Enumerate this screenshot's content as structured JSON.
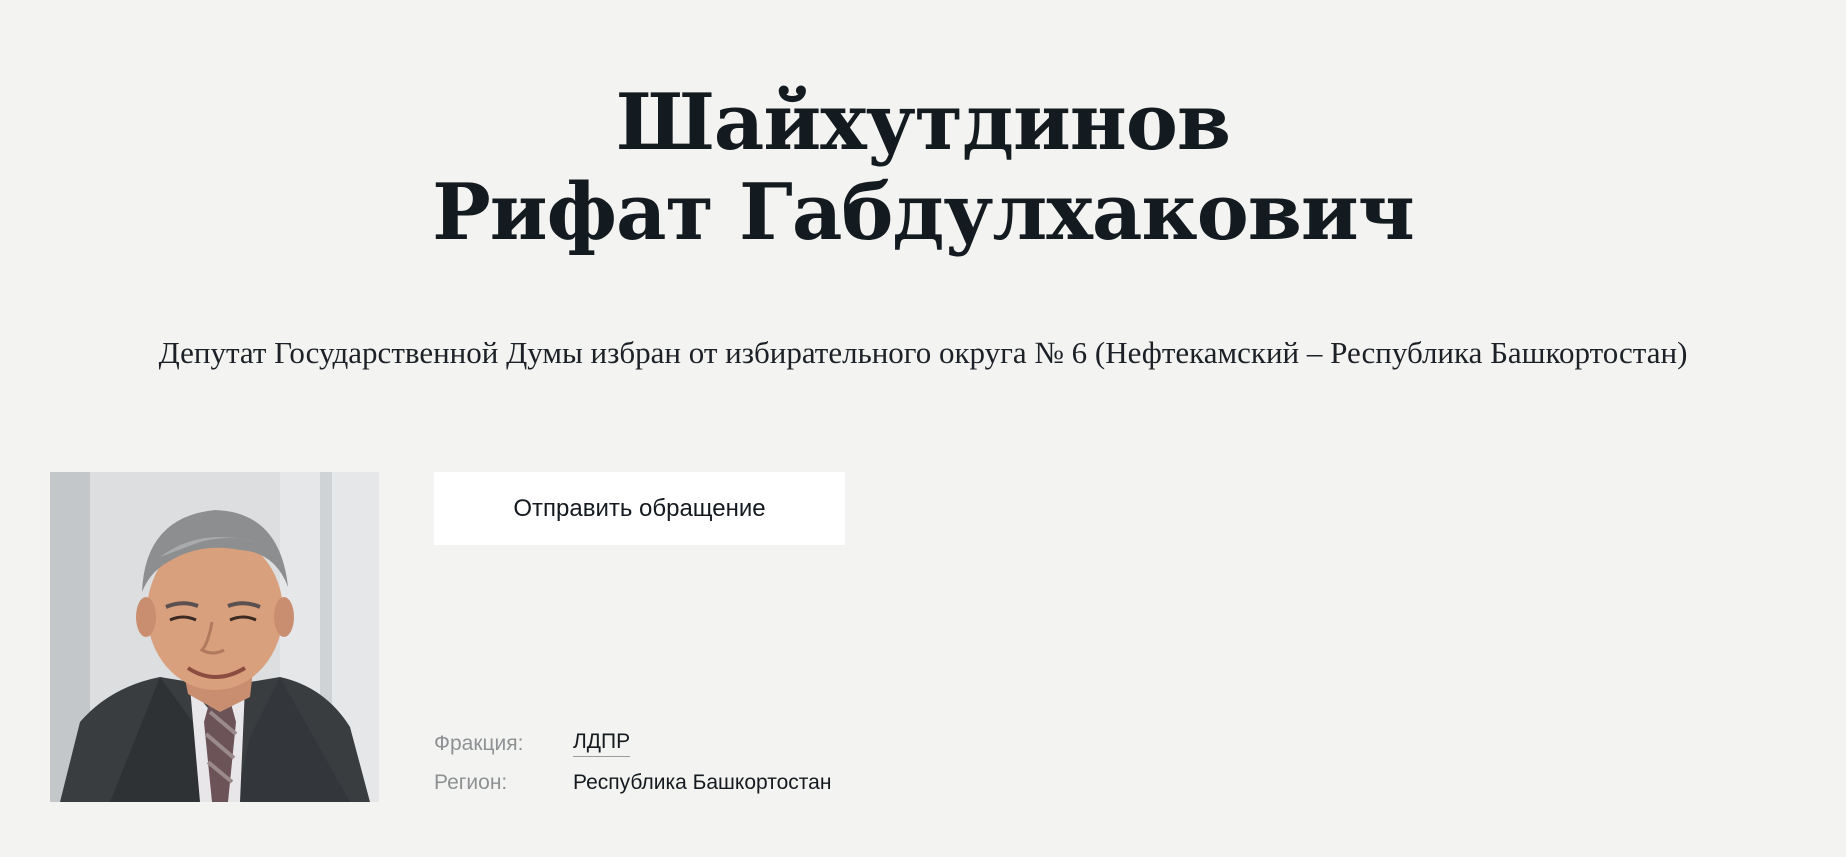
{
  "deputy": {
    "surname": "Шайхутдинов",
    "given_names": "Рифат Габдулхакович",
    "position": "Депутат Государственной Думы избран от избирательного округа № 6 (Нефтекамский – Республика Башкортостан)"
  },
  "actions": {
    "appeal_button_label": "Отправить обращение"
  },
  "info": {
    "faction_label": "Фракция:",
    "faction_value": "ЛДПР",
    "region_label": "Регион:",
    "region_value": "Республика Башкортостан"
  }
}
